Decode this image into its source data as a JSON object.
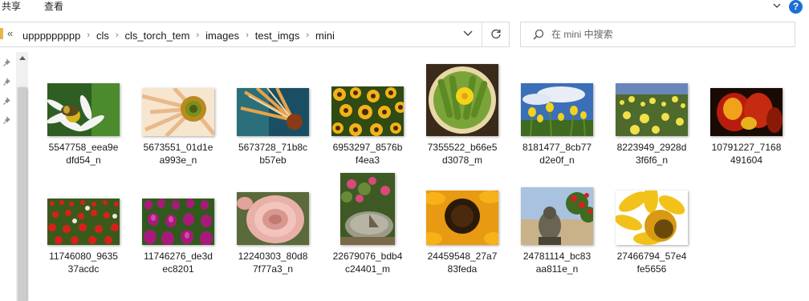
{
  "ribbon": {
    "share_label": "共享",
    "view_label": "查看",
    "help_label": "?"
  },
  "address": {
    "lead": "«",
    "crumbs": [
      "uppppppppp",
      "cls",
      "cls_torch_tem",
      "images",
      "test_imgs",
      "mini"
    ]
  },
  "search": {
    "placeholder": "在 mini 中搜索"
  },
  "files": [
    {
      "line1": "5547758_eea9e",
      "line2": "dfd54_n",
      "icon": "bee-on-daisy-thumbnail"
    },
    {
      "line1": "5673551_01d1e",
      "line2": "a993e_n",
      "icon": "peach-gerbera-thumbnail"
    },
    {
      "line1": "5673728_71b8c",
      "line2": "b57eb",
      "icon": "teal-orange-petals-thumbnail"
    },
    {
      "line1": "6953297_8576b",
      "line2": "f4ea3",
      "icon": "sunflower-field-thumbnail"
    },
    {
      "line1": "7355522_b66e5",
      "line2": "d3078_m",
      "icon": "flower-on-plate-thumbnail"
    },
    {
      "line1": "8181477_8cb77",
      "line2": "d2e0f_n",
      "icon": "yellow-flowers-sky-thumbnail"
    },
    {
      "line1": "8223949_2928d",
      "line2": "3f6f6_n",
      "icon": "meadow-flowers-thumbnail"
    },
    {
      "line1": "10791227_7168",
      "line2": "491604",
      "icon": "red-tulip-thumbnail"
    },
    {
      "line1": "11746080_9635",
      "line2": "37acdc",
      "icon": "tulip-field-thumbnail"
    },
    {
      "line1": "11746276_de3d",
      "line2": "ec8201",
      "icon": "purple-tulips-thumbnail"
    },
    {
      "line1": "12240303_80d8",
      "line2": "7f77a3_n",
      "icon": "pink-rose-thumbnail"
    },
    {
      "line1": "22679076_bdb4",
      "line2": "c24401_m",
      "icon": "sundial-garden-thumbnail"
    },
    {
      "line1": "24459548_27a7",
      "line2": "83feda",
      "icon": "sunflower-closeup-thumbnail"
    },
    {
      "line1": "24781114_bc83",
      "line2": "aa811e_n",
      "icon": "statue-roses-thumbnail"
    },
    {
      "line1": "27466794_57e4",
      "line2": "fe5656",
      "icon": "yellow-sunflower-thumbnail"
    }
  ]
}
